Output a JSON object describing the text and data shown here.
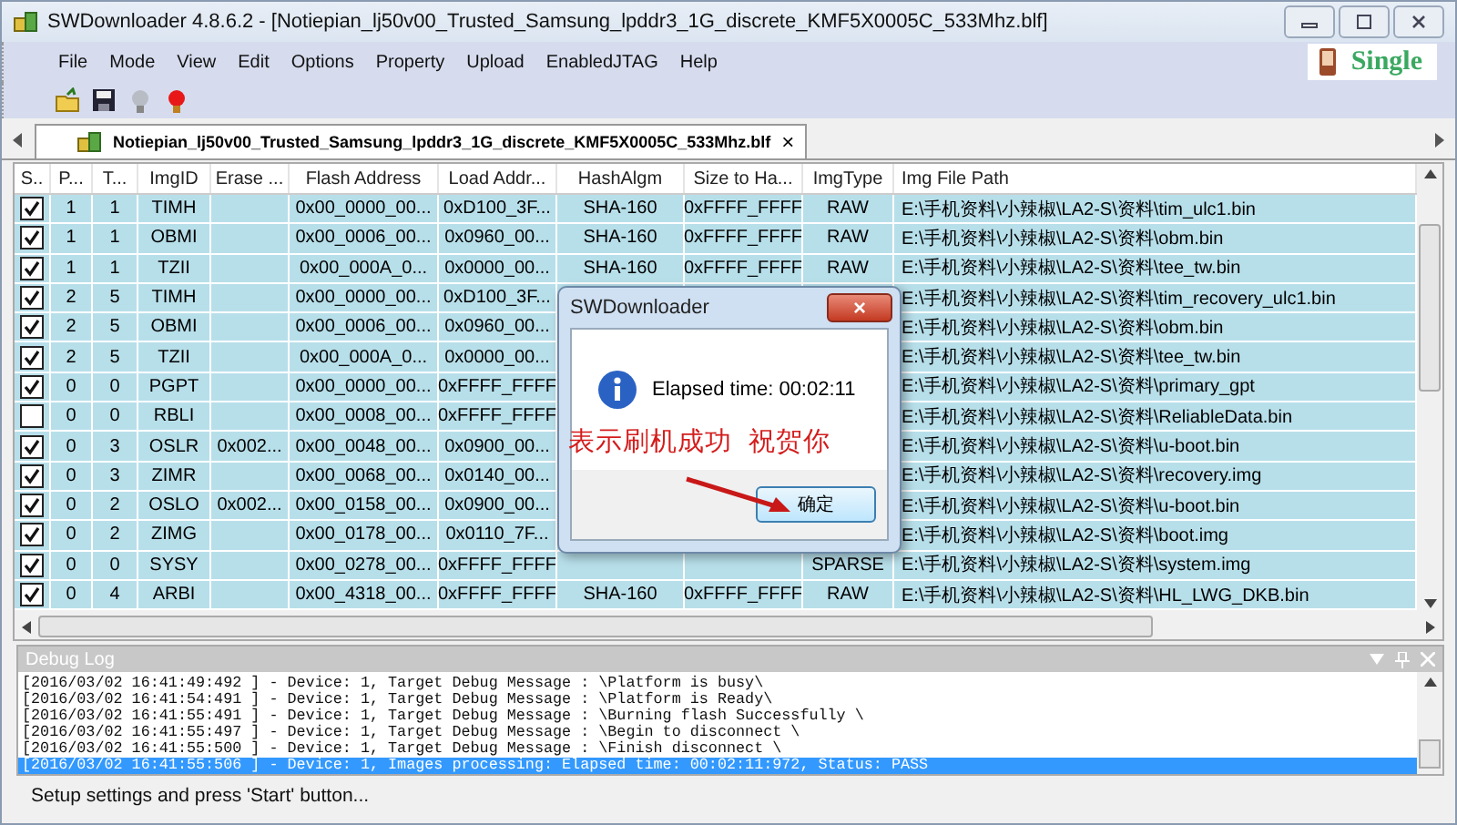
{
  "window": {
    "title": "SWDownloader 4.8.6.2 - [Notiepian_lj50v00_Trusted_Samsung_lpddr3_1G_discrete_KMF5X0005C_533Mhz.blf]"
  },
  "menu": [
    "File",
    "Mode",
    "View",
    "Edit",
    "Options",
    "Property",
    "Upload",
    "EnabledJTAG",
    "Help"
  ],
  "mode_label": "Single",
  "tabs": [
    {
      "label": "Notiepian_lj50v00_Trusted_Samsung_lpddr3_1G_discrete_KMF5X0005C_533Mhz.blf",
      "selected": true,
      "close": "×"
    }
  ],
  "table": {
    "columns": [
      "S..",
      "P...",
      "T...",
      "ImgID",
      "Erase ...",
      "Flash Address",
      "Load Addr...",
      "HashAlgm",
      "Size to Ha...",
      "ImgType",
      "Img File Path"
    ],
    "rows": [
      {
        "cells": [
          {
            "checked": true
          },
          "1",
          "1",
          "TIMH",
          "",
          "0x00_0000_00...",
          "0xD100_3F...",
          "SHA-160",
          "0xFFFF_FFFF",
          "RAW",
          "E:\\手机资料\\小辣椒\\LA2-S\\资料\\tim_ulc1.bin"
        ]
      },
      {
        "cells": [
          {
            "checked": true
          },
          "1",
          "1",
          "OBMI",
          "",
          "0x00_0006_00...",
          "0x0960_00...",
          "SHA-160",
          "0xFFFF_FFFF",
          "RAW",
          "E:\\手机资料\\小辣椒\\LA2-S\\资料\\obm.bin"
        ]
      },
      {
        "cells": [
          {
            "checked": true
          },
          "1",
          "1",
          "TZII",
          "",
          "0x00_000A_0...",
          "0x0000_00...",
          "SHA-160",
          "0xFFFF_FFFF",
          "RAW",
          "E:\\手机资料\\小辣椒\\LA2-S\\资料\\tee_tw.bin"
        ]
      },
      {
        "cells": [
          {
            "checked": true
          },
          "2",
          "5",
          "TIMH",
          "",
          "0x00_0000_00...",
          "0xD100_3F...",
          "",
          "",
          "",
          "E:\\手机资料\\小辣椒\\LA2-S\\资料\\tim_recovery_ulc1.bin"
        ]
      },
      {
        "cells": [
          {
            "checked": true
          },
          "2",
          "5",
          "OBMI",
          "",
          "0x00_0006_00...",
          "0x0960_00...",
          "",
          "",
          "",
          "E:\\手机资料\\小辣椒\\LA2-S\\资料\\obm.bin"
        ]
      },
      {
        "cells": [
          {
            "checked": true
          },
          "2",
          "5",
          "TZII",
          "",
          "0x00_000A_0...",
          "0x0000_00...",
          "",
          "",
          "",
          "E:\\手机资料\\小辣椒\\LA2-S\\资料\\tee_tw.bin"
        ]
      },
      {
        "cells": [
          {
            "checked": true
          },
          "0",
          "0",
          "PGPT",
          "",
          "0x00_0000_00...",
          "0xFFFF_FFFF",
          "",
          "",
          "",
          "E:\\手机资料\\小辣椒\\LA2-S\\资料\\primary_gpt"
        ]
      },
      {
        "cells": [
          {
            "checked": false
          },
          "0",
          "0",
          "RBLI",
          "",
          "0x00_0008_00...",
          "0xFFFF_FFFF",
          "",
          "",
          "",
          "E:\\手机资料\\小辣椒\\LA2-S\\资料\\ReliableData.bin"
        ]
      },
      {
        "cells": [
          {
            "checked": true
          },
          "0",
          "3",
          "OSLR",
          "0x002...",
          "0x00_0048_00...",
          "0x0900_00...",
          "",
          "",
          "",
          "E:\\手机资料\\小辣椒\\LA2-S\\资料\\u-boot.bin"
        ]
      },
      {
        "cells": [
          {
            "checked": true
          },
          "0",
          "3",
          "ZIMR",
          "",
          "0x00_0068_00...",
          "0x0140_00...",
          "",
          "",
          "",
          "E:\\手机资料\\小辣椒\\LA2-S\\资料\\recovery.img"
        ]
      },
      {
        "cells": [
          {
            "checked": true
          },
          "0",
          "2",
          "OSLO",
          "0x002...",
          "0x00_0158_00...",
          "0x0900_00...",
          "",
          "",
          "",
          "E:\\手机资料\\小辣椒\\LA2-S\\资料\\u-boot.bin"
        ]
      },
      {
        "cells": [
          {
            "checked": true
          },
          "0",
          "2",
          "ZIMG",
          "",
          "0x00_0178_00...",
          "0x0110_7F...",
          "",
          "",
          "",
          "E:\\手机资料\\小辣椒\\LA2-S\\资料\\boot.img"
        ]
      },
      {
        "cells": [
          {
            "checked": true
          },
          "0",
          "0",
          "SYSY",
          "",
          "0x00_0278_00...",
          "0xFFFF_FFFF",
          "",
          "",
          "SPARSE",
          "E:\\手机资料\\小辣椒\\LA2-S\\资料\\system.img"
        ]
      },
      {
        "cells": [
          {
            "checked": true
          },
          "0",
          "4",
          "ARBI",
          "",
          "0x00_4318_00...",
          "0xFFFF_FFFF",
          "SHA-160",
          "0xFFFF_FFFF",
          "RAW",
          "E:\\手机资料\\小辣椒\\LA2-S\\资料\\HL_LWG_DKB.bin"
        ]
      }
    ]
  },
  "dialog": {
    "title": "SWDownloader",
    "close": "×",
    "message": "Elapsed time: 00:02:11",
    "button": "确定"
  },
  "annotation": {
    "text": "表示刷机成功  祝贺你"
  },
  "debug_log": {
    "title": "Debug Log",
    "lines": [
      {
        "text": "[2016/03/02 16:41:49:492 ] - Device: 1, Target Debug Message : \\Platform is busy\\",
        "selected": false
      },
      {
        "text": "[2016/03/02 16:41:54:491 ] - Device: 1, Target Debug Message : \\Platform is Ready\\",
        "selected": false
      },
      {
        "text": "[2016/03/02 16:41:55:491 ] - Device: 1, Target Debug Message : \\Burning flash Successfully \\",
        "selected": false
      },
      {
        "text": "[2016/03/02 16:41:55:497 ] - Device: 1, Target Debug Message : \\Begin to disconnect \\",
        "selected": false
      },
      {
        "text": "[2016/03/02 16:41:55:500 ] - Device: 1, Target Debug Message : \\Finish disconnect \\",
        "selected": false
      },
      {
        "text": "[2016/03/02 16:41:55:506 ] - Device: 1, Images processing: Elapsed time: 00:02:11:972, Status: PASS",
        "selected": true
      }
    ]
  },
  "status_bar": "Setup settings and press 'Start' button..."
}
